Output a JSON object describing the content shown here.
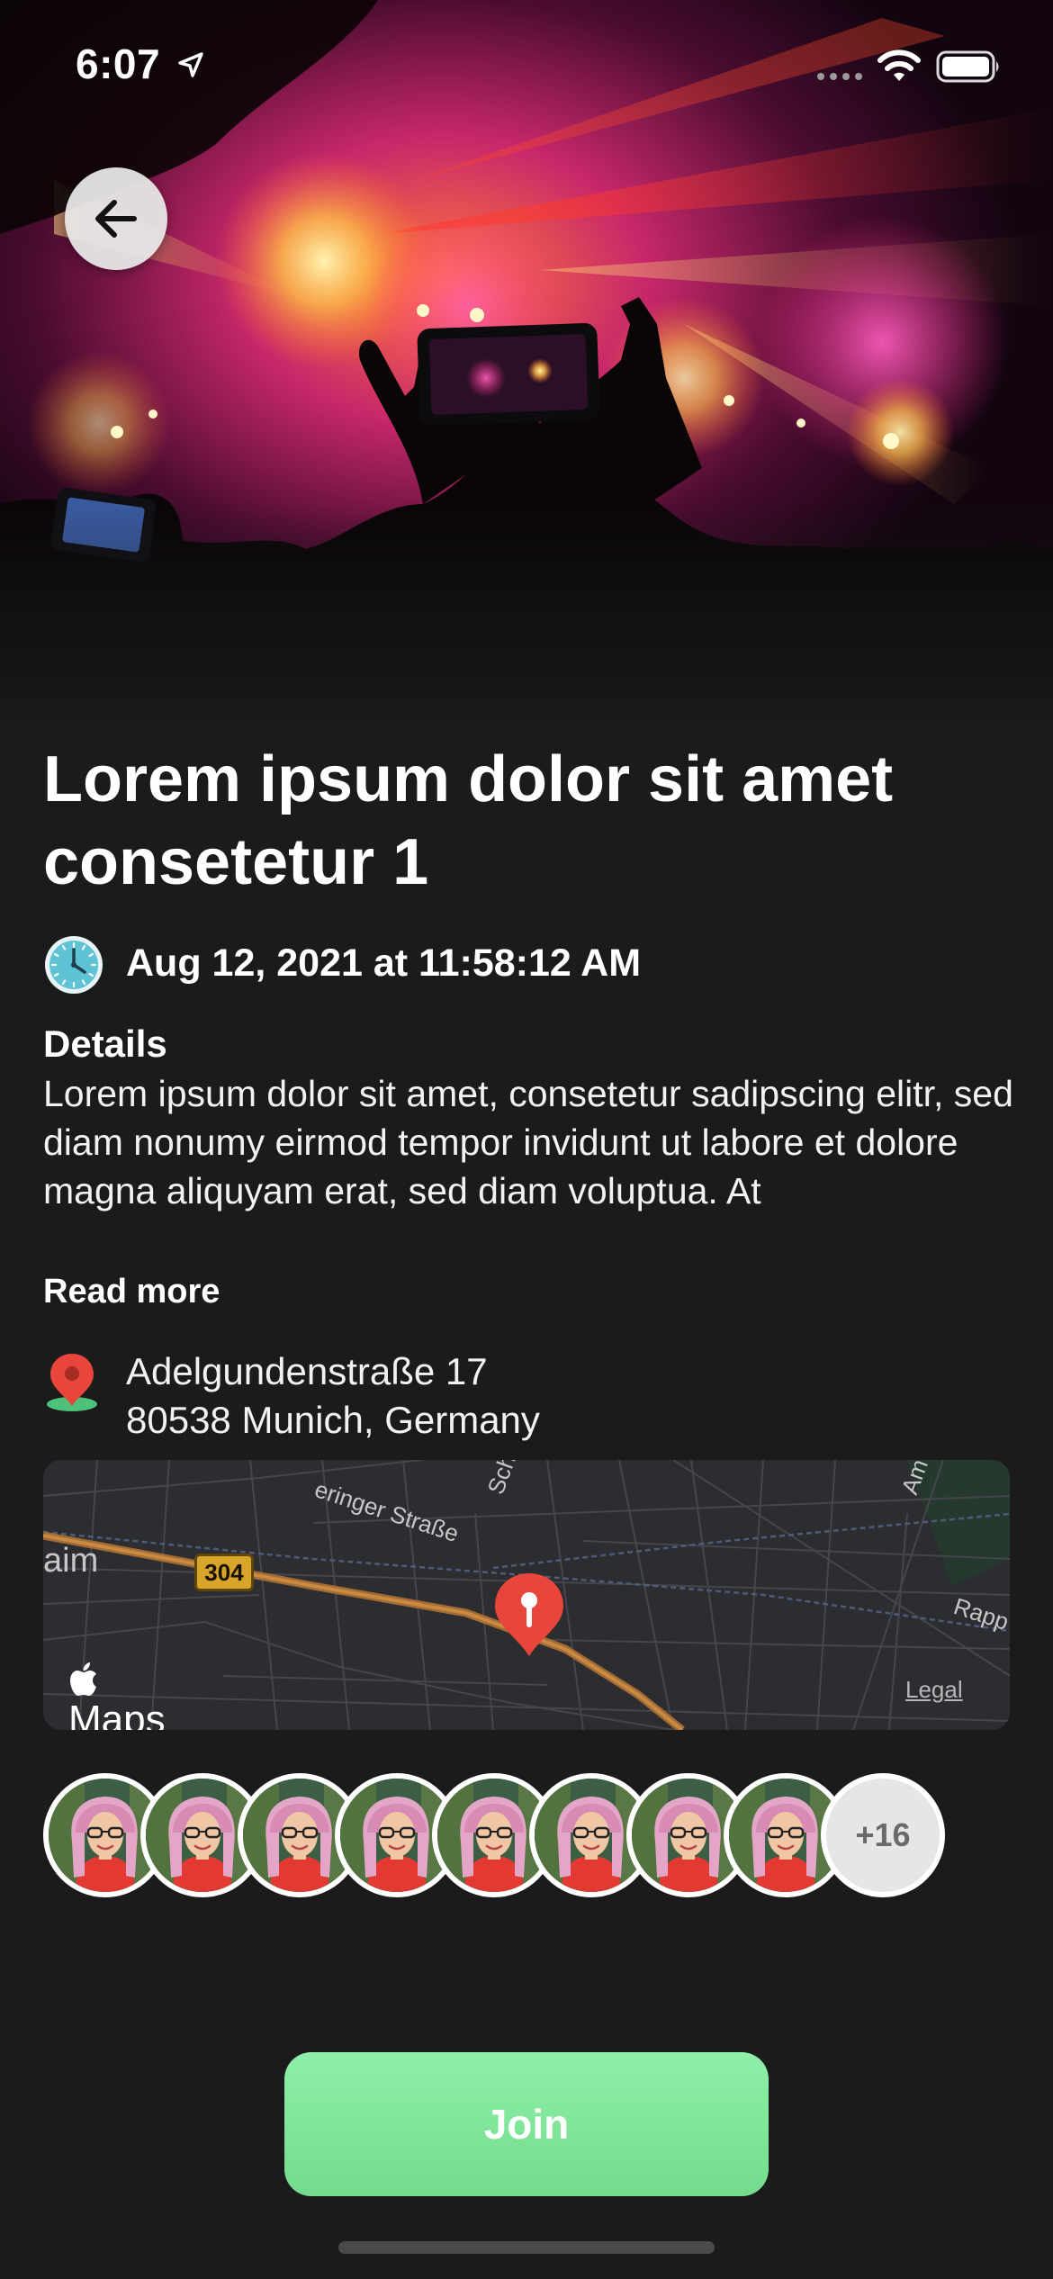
{
  "status_bar": {
    "time": "6:07"
  },
  "event": {
    "title": "Lorem ipsum dolor sit amet consetetur 1",
    "datetime": "Aug 12, 2021 at 11:58:12 AM",
    "details_heading": "Details",
    "details_text": "Lorem ipsum dolor sit amet, consetetur sadipscing elitr, sed diam nonumy eirmod tempor invidunt ut labore et dolore magna aliquyam erat, sed diam voluptua. At",
    "read_more_label": "Read more",
    "address_line1": "Adelgundenstraße 17",
    "address_line2": "80538 Munich, Germany"
  },
  "map": {
    "logo_text": "Maps",
    "legal_label": "Legal",
    "road_number": "304",
    "labels": {
      "place_left": "aim",
      "street_top": "eringer Straße",
      "street_diag": "Scha",
      "street_right_top": "Am",
      "street_right": "Rapp"
    }
  },
  "attendees": {
    "visible_avatars": 8,
    "more_count_label": "+16"
  },
  "actions": {
    "join_label": "Join"
  },
  "icons": {
    "back": "arrow-left-icon",
    "clock": "clock-icon",
    "location": "map-pin-icon",
    "status_location": "location-arrow-icon",
    "wifi": "wifi-icon",
    "battery": "battery-icon"
  },
  "colors": {
    "background": "#1b1b1c",
    "join_button": "#7fe69a",
    "pin_red": "#e8453c",
    "clock_teal": "#5fc3d6"
  }
}
